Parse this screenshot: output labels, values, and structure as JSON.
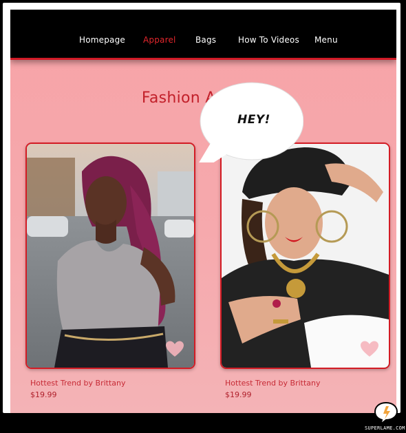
{
  "nav": {
    "items": [
      {
        "label": "Homepage"
      },
      {
        "label": "Apparel"
      },
      {
        "label": "Bags"
      },
      {
        "label": "How To Videos"
      },
      {
        "label": "Menu"
      }
    ],
    "active_index": 1
  },
  "heading": "Fashion Apparel",
  "bubble": {
    "text": "HEY!"
  },
  "products": [
    {
      "title": "Hottest Trend by Brittany",
      "price": "$19.99",
      "icon": "heart-icon"
    },
    {
      "title": "Hottest Trend by Brittany",
      "price": "$19.99",
      "icon": "heart-icon"
    }
  ],
  "watermark": "SUPERLAME.COM",
  "colors": {
    "accent": "#d11a26",
    "background": "#f7a3a7",
    "nav": "#000000"
  }
}
